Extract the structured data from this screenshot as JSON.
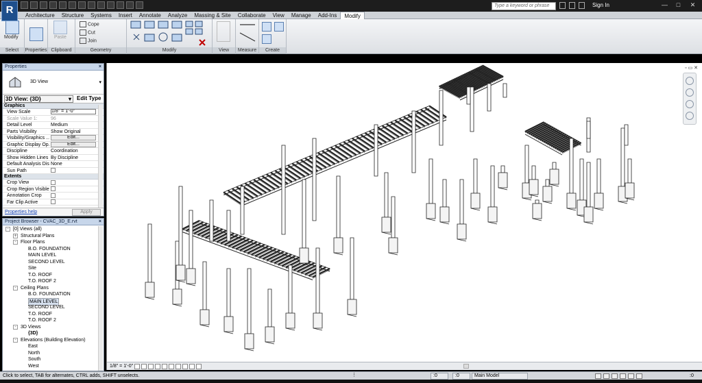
{
  "app": {
    "logo_letter": "R"
  },
  "search": {
    "placeholder": "Type a keyword or phrase"
  },
  "account": {
    "signin_label": "Sign In"
  },
  "menu": {
    "tabs": [
      "Architecture",
      "Structure",
      "Systems",
      "Insert",
      "Annotate",
      "Analyze",
      "Massing & Site",
      "Collaborate",
      "View",
      "Manage",
      "Add-Ins",
      "Modify"
    ],
    "active_tab": "Modify"
  },
  "ribbon": {
    "select": {
      "label": "Modify",
      "panel": "Select"
    },
    "properties_panel": "Properties",
    "clipboard": {
      "paste": "Paste",
      "panel": "Clipboard"
    },
    "geometry": {
      "cope": "Cope",
      "cut": "Cut",
      "join": "Join",
      "panel": "Geometry"
    },
    "modify_panel": "Modify",
    "view_panel": "View",
    "measure_panel": "Measure",
    "create_panel": "Create"
  },
  "properties": {
    "title": "Properties",
    "type_name": "3D View",
    "view_selector": "3D View: {3D}",
    "edit_type": "Edit Type",
    "groups": [
      {
        "name": "Graphics",
        "rows": [
          {
            "key": "View Scale",
            "value": "1/8\" = 1'-0\"",
            "kind": "field"
          },
          {
            "key": "Scale Value    1:",
            "value": "96",
            "kind": "dim"
          },
          {
            "key": "Detail Level",
            "value": "Medium",
            "kind": "text"
          },
          {
            "key": "Parts Visibility",
            "value": "Show Original",
            "kind": "text"
          },
          {
            "key": "Visibility/Graphics ...",
            "value": "Edit...",
            "kind": "button"
          },
          {
            "key": "Graphic Display Op...",
            "value": "Edit...",
            "kind": "button"
          },
          {
            "key": "Discipline",
            "value": "Coordination",
            "kind": "text"
          },
          {
            "key": "Show Hidden Lines",
            "value": "By Discipline",
            "kind": "text"
          },
          {
            "key": "Default Analysis Dis...",
            "value": "None",
            "kind": "text"
          },
          {
            "key": "Sun Path",
            "value": "",
            "kind": "check"
          }
        ]
      },
      {
        "name": "Extents",
        "rows": [
          {
            "key": "Crop View",
            "value": "",
            "kind": "check"
          },
          {
            "key": "Crop Region Visible",
            "value": "",
            "kind": "check"
          },
          {
            "key": "Annotation Crop",
            "value": "",
            "kind": "check"
          },
          {
            "key": "Far Clip Active",
            "value": "",
            "kind": "check"
          }
        ]
      }
    ],
    "help_link": "Properties help",
    "apply_label": "Apply"
  },
  "browser": {
    "title": "Project Browser - CVAC_3D_E.rvt",
    "nodes": [
      {
        "label": "[0] Views (all)",
        "level": 0,
        "toggle": "-"
      },
      {
        "label": "Structural Plans",
        "level": 1,
        "toggle": "+"
      },
      {
        "label": "Floor Plans",
        "level": 1,
        "toggle": "-"
      },
      {
        "label": "B.O. FOUNDATION",
        "level": 2,
        "toggle": ""
      },
      {
        "label": "MAIN LEVEL",
        "level": 2,
        "toggle": ""
      },
      {
        "label": "SECOND LEVEL",
        "level": 2,
        "toggle": ""
      },
      {
        "label": "Site",
        "level": 2,
        "toggle": ""
      },
      {
        "label": "T.O. ROOF",
        "level": 2,
        "toggle": ""
      },
      {
        "label": "T.O. ROOF 2",
        "level": 2,
        "toggle": ""
      },
      {
        "label": "Ceiling Plans",
        "level": 1,
        "toggle": "-"
      },
      {
        "label": "B.O. FOUNDATION",
        "level": 2,
        "toggle": ""
      },
      {
        "label": "MAIN LEVEL",
        "level": 2,
        "toggle": "",
        "selected": true
      },
      {
        "label": "SECOND LEVEL",
        "level": 2,
        "toggle": ""
      },
      {
        "label": "T.O. ROOF",
        "level": 2,
        "toggle": ""
      },
      {
        "label": "T.O. ROOF 2",
        "level": 2,
        "toggle": ""
      },
      {
        "label": "3D Views",
        "level": 1,
        "toggle": "-"
      },
      {
        "label": "{3D}",
        "level": 2,
        "toggle": "",
        "bold": true
      },
      {
        "label": "Elevations (Building Elevation)",
        "level": 1,
        "toggle": "-"
      },
      {
        "label": "East",
        "level": 2,
        "toggle": ""
      },
      {
        "label": "North",
        "level": 2,
        "toggle": ""
      },
      {
        "label": "South",
        "level": 2,
        "toggle": ""
      },
      {
        "label": "West",
        "level": 2,
        "toggle": ""
      }
    ]
  },
  "canvas": {
    "scale_label": "1/8\" = 1'-0\""
  },
  "status": {
    "hint": "Click to select, TAB for alternates, CTRL adds, SHIFT unselects.",
    "zero_a": ":0",
    "zero_b": ":0",
    "model": "Main Model",
    "filter_count": ":0"
  },
  "colors": {
    "ribbon_blue": "#1e4f8c",
    "pane_header": "#c7d6ea"
  }
}
